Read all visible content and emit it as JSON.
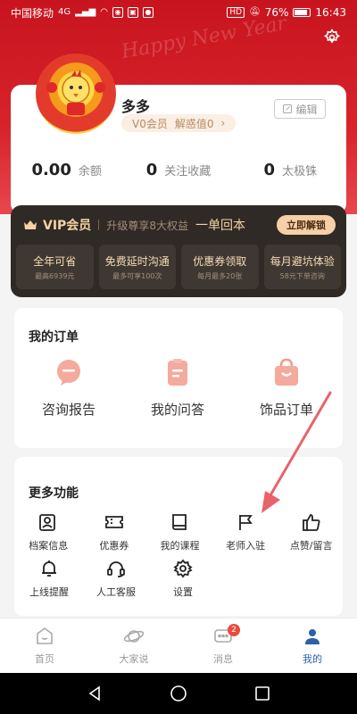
{
  "status_bar": {
    "carrier": "中国移动",
    "network": "4G",
    "hd": "HD",
    "battery": "76%",
    "time": "16:43"
  },
  "header": {
    "decoration_text": "Happy New Year",
    "settings_icon": "gear-icon"
  },
  "profile": {
    "username": "多多",
    "vip_level": "V0会员",
    "unlock_text": "解惑值0",
    "edit_label": "编辑",
    "stats": [
      {
        "value": "0.00",
        "label": "余额"
      },
      {
        "value": "0",
        "label": "关注收藏"
      },
      {
        "value": "0",
        "label": "太极铢"
      }
    ]
  },
  "vip": {
    "title": "VIP会员",
    "subtitle": "升级尊享8大权益",
    "slogan": "一单回本",
    "unlock_button": "立即解锁",
    "benefits": [
      {
        "title": "全年可省",
        "sub": "最高6939元"
      },
      {
        "title": "免费延时沟通",
        "sub": "最多可享100次"
      },
      {
        "title": "优惠券领取",
        "sub": "每月最多20张"
      },
      {
        "title": "每月避坑体验",
        "sub": "58元下单咨询"
      }
    ]
  },
  "orders": {
    "title": "我的订单",
    "items": [
      {
        "label": "咨询报告",
        "icon": "chat-bubble-icon"
      },
      {
        "label": "我的问答",
        "icon": "clipboard-icon"
      },
      {
        "label": "饰品订单",
        "icon": "shopping-bag-icon"
      }
    ]
  },
  "more": {
    "title": "更多功能",
    "items": [
      {
        "label": "档案信息",
        "icon": "profile-card-icon"
      },
      {
        "label": "优惠券",
        "icon": "coupon-icon"
      },
      {
        "label": "我的课程",
        "icon": "book-icon"
      },
      {
        "label": "老师入驻",
        "icon": "flag-icon"
      },
      {
        "label": "点赞/留言",
        "icon": "thumbs-up-icon"
      },
      {
        "label": "上线提醒",
        "icon": "bell-icon"
      },
      {
        "label": "人工客服",
        "icon": "headset-icon"
      },
      {
        "label": "设置",
        "icon": "settings-icon"
      }
    ]
  },
  "bottom_nav": {
    "items": [
      {
        "label": "首页",
        "icon": "home-icon"
      },
      {
        "label": "大家说",
        "icon": "planet-icon"
      },
      {
        "label": "消息",
        "icon": "message-icon",
        "badge": "2"
      },
      {
        "label": "我的",
        "icon": "person-icon",
        "active": true
      }
    ]
  },
  "colors": {
    "header_red": "#d8232b",
    "vip_dark": "#2f2a25",
    "vip_gold": "#f4d2a4",
    "icon_salmon": "#f29b8b",
    "arrow": "#e8636b",
    "nav_active": "#2d5fa8"
  }
}
